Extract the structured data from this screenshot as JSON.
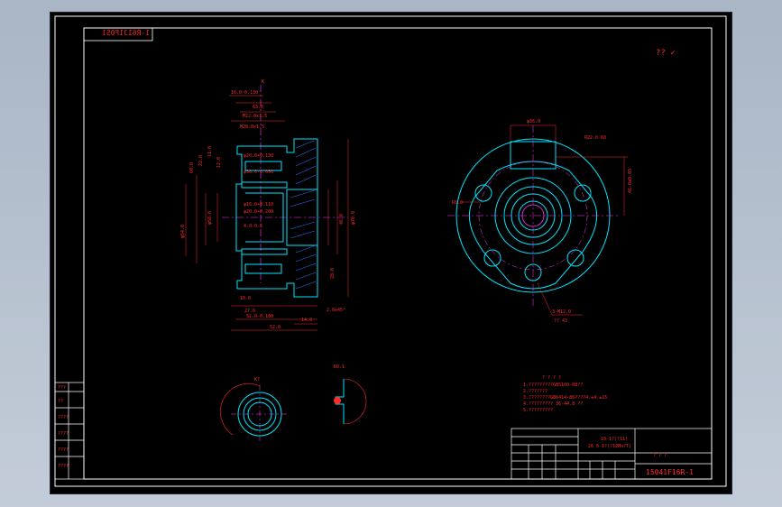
{
  "drawing": {
    "stamp_top_left": "1-R61J1F0S1",
    "check_marks": "?? ✓",
    "view_k_label": "K",
    "view_k_title": "K?",
    "detail_title": "R0.1",
    "hole_callout_1": "3-M12.0",
    "hole_callout_2": "?? 43",
    "dims_front": [
      "16.0-0.130",
      "63.0",
      "M22.0x1.5",
      "M28.0x1.5",
      "φ20.0+0.130",
      "φ30.0-0.050",
      "φ16.0+0.110",
      "φ20.0+0.280",
      "4.0-0.5",
      "10.0",
      "27.0",
      "52.0-0.180",
      "52.0",
      "14.0",
      "2.0x45°",
      "φ54.0",
      "φ70.0",
      "φ58.0",
      "46.0",
      "φ56.0",
      "60.0",
      "11.0",
      "22.0",
      "28.0",
      "12.0"
    ],
    "dims_side": [
      "φ36.0",
      "R22.0",
      "46.0±0.05",
      "R8.0",
      "60"
    ],
    "tech_notes_title": "? ? ? ?",
    "tech_notes": [
      "1.?????????GB5100-88??",
      "2.???????",
      "3.????????GB6414-86????4.±4.±15",
      "4.????????? 36-44.8 ??",
      "5.?????????"
    ],
    "title_block": {
      "part_name_1": "10-1?(?11)",
      "part_name_2": "26 0-1?(?12Mo?T)",
      "drawing_no": "15041F16R-1",
      "sheet_marks": "? ? ?",
      "left_col_top": "???",
      "left_cells": [
        "??",
        "????",
        "????",
        "????",
        "????"
      ]
    }
  }
}
